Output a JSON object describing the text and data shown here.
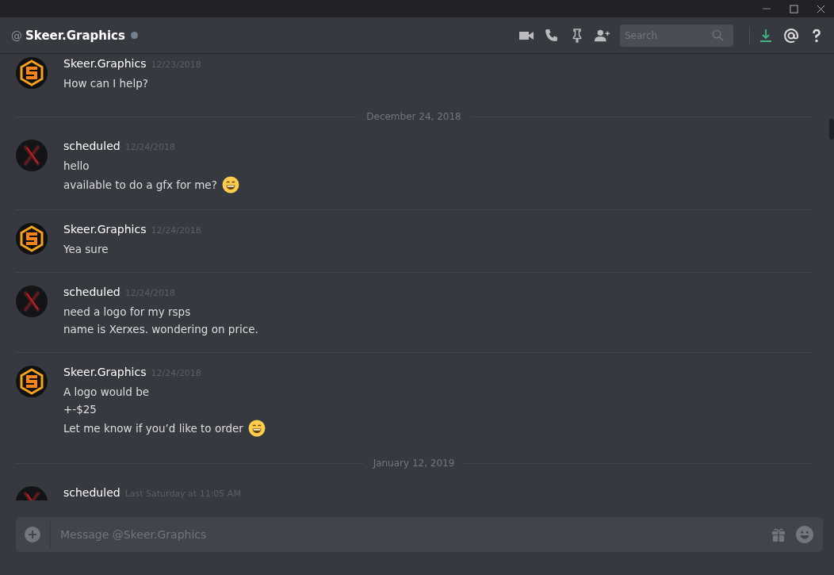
{
  "header": {
    "at": "@",
    "name": "Skeer.Graphics",
    "search": {
      "placeholder": "Search"
    }
  },
  "messages": [
    {
      "kind": "message",
      "author": "Skeer.Graphics",
      "avatar": {
        "kind": "logo"
      },
      "time": "12/23/2018",
      "lines": [
        {
          "text": "How can I help?",
          "emoji": false
        }
      ]
    },
    {
      "kind": "divider",
      "label": "December 24, 2018"
    },
    {
      "kind": "message",
      "author": "scheduled",
      "avatar": {
        "kind": "x"
      },
      "time": "12/24/2018",
      "lines": [
        {
          "text": "hello",
          "emoji": false
        },
        {
          "text": "available to do a gfx for me?",
          "emoji": true
        }
      ]
    },
    {
      "kind": "message",
      "author": "Skeer.Graphics",
      "avatar": {
        "kind": "logo"
      },
      "time": "12/24/2018",
      "lines": [
        {
          "text": "Yea sure",
          "emoji": false
        }
      ]
    },
    {
      "kind": "message",
      "author": "scheduled",
      "avatar": {
        "kind": "x"
      },
      "time": "12/24/2018",
      "lines": [
        {
          "text": "need a logo for my rsps",
          "emoji": false
        },
        {
          "text": "name is Xerxes. wondering on price.",
          "emoji": false
        }
      ]
    },
    {
      "kind": "message",
      "author": "Skeer.Graphics",
      "avatar": {
        "kind": "logo"
      },
      "time": "12/24/2018",
      "lines": [
        {
          "text": "A logo would be",
          "emoji": false
        },
        {
          "text": "+-$25",
          "emoji": false
        },
        {
          "text": "Let me know if you’d like to order",
          "emoji": true
        }
      ]
    },
    {
      "kind": "divider",
      "label": "January 12, 2019"
    },
    {
      "kind": "message",
      "author": "scheduled",
      "avatar": {
        "kind": "x"
      },
      "time": "Last Saturday at 11:05 AM"
    }
  ],
  "composer": {
    "placeholder": "Message @Skeer.Graphics"
  }
}
